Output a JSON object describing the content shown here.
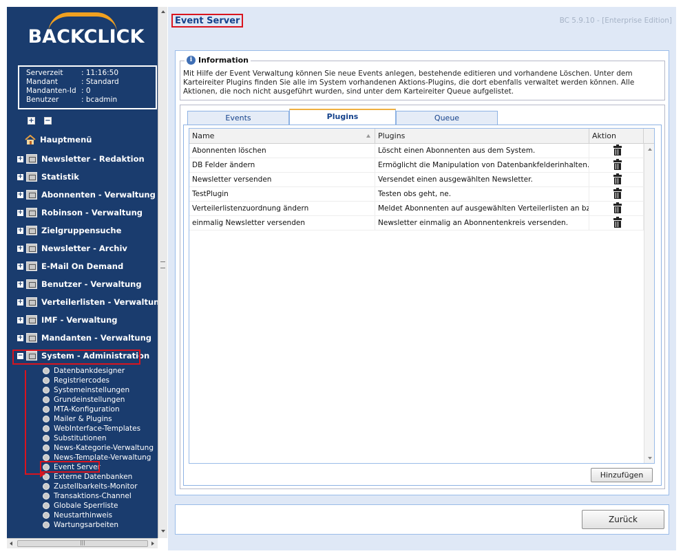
{
  "brand": {
    "logo_text": "BACKCLICK"
  },
  "server_info": [
    {
      "key": "Serverzeit",
      "value": ": 11:16:50"
    },
    {
      "key": "Mandant",
      "value": ": Standard"
    },
    {
      "key": "Mandanten-Id",
      "value": ": 0"
    },
    {
      "key": "Benutzer",
      "value": ": bcadmin"
    }
  ],
  "tree_controls": {
    "expand_all": "+",
    "collapse_all": "−"
  },
  "nav": [
    {
      "label": "Hauptmenü",
      "icon": "house-icon"
    },
    {
      "label": "Newsletter - Redaktion",
      "icon": "folder-icon"
    },
    {
      "label": "Statistik",
      "icon": "folder-icon"
    },
    {
      "label": "Abonnenten - Verwaltung",
      "icon": "folder-icon"
    },
    {
      "label": "Robinson - Verwaltung",
      "icon": "folder-icon"
    },
    {
      "label": "Zielgruppensuche",
      "icon": "folder-icon"
    },
    {
      "label": "Newsletter - Archiv",
      "icon": "folder-icon"
    },
    {
      "label": "E-Mail On Demand",
      "icon": "folder-icon"
    },
    {
      "label": "Benutzer - Verwaltung",
      "icon": "folder-icon"
    },
    {
      "label": "Verteilerlisten - Verwaltung",
      "icon": "folder-icon"
    },
    {
      "label": "IMF - Verwaltung",
      "icon": "folder-icon"
    },
    {
      "label": "Mandanten - Verwaltung",
      "icon": "folder-icon"
    },
    {
      "label": "System - Administration",
      "icon": "gears-icon"
    }
  ],
  "subnav": [
    "Datenbankdesigner",
    "Registriercodes",
    "Systemeinstellungen",
    "Grundeinstellungen",
    "MTA-Konfiguration",
    "Mailer & Plugins",
    "WebInterface-Templates",
    "Substitutionen",
    "News-Kategorie-Verwaltung",
    "News-Template-Verwaltung",
    "Event Server",
    "Externe Datenbanken",
    "Zustellbarkeits-Monitor",
    "Transaktions-Channel",
    "Globale Sperrliste",
    "Neustarthinweis",
    "Wartungsarbeiten"
  ],
  "header": {
    "title": "Event Server",
    "version": "BC 5.9.10 - [Enterprise Edition]"
  },
  "info": {
    "legend": "Information",
    "text": "Mit Hilfe der Event Verwaltung können Sie neue Events anlegen, bestehende editieren und vorhandene Löschen. Unter dem Karteireiter Plugins finden Sie alle im System vorhandenen Aktions-Plugins, die dort ebenfalls verwaltet werden können. Alle Aktionen, die noch nicht ausgeführt wurden, sind unter dem Karteireiter Queue aufgelistet."
  },
  "tabs": [
    {
      "label": "Events"
    },
    {
      "label": "Plugins"
    },
    {
      "label": "Queue"
    }
  ],
  "grid": {
    "columns": [
      "Name",
      "Plugins",
      "Aktion"
    ],
    "rows": [
      {
        "name": "Abonnenten löschen",
        "plugin": "Löscht einen Abonnenten aus dem System."
      },
      {
        "name": "DB Felder ändern",
        "plugin": "Ermöglicht die Manipulation von Datenbankfelderinhalten."
      },
      {
        "name": "Newsletter versenden",
        "plugin": "Versendet einen ausgewählten Newsletter."
      },
      {
        "name": "TestPlugin",
        "plugin": "Testen obs geht, ne."
      },
      {
        "name": "Verteilerlistenzuordnung ändern",
        "plugin": "Meldet Abonnenten auf ausgewählten Verteilerlisten an bzw. ab"
      },
      {
        "name": "einmalig Newsletter versenden",
        "plugin": "Newsletter einmalig an Abonnentenkreis versenden."
      }
    ]
  },
  "buttons": {
    "add": "Hinzufügen",
    "back": "Zurück"
  },
  "colors": {
    "sidebar": "#1a3c6e",
    "accent": "#f0a020",
    "highlight": "#d9141e",
    "title": "#15428b"
  }
}
